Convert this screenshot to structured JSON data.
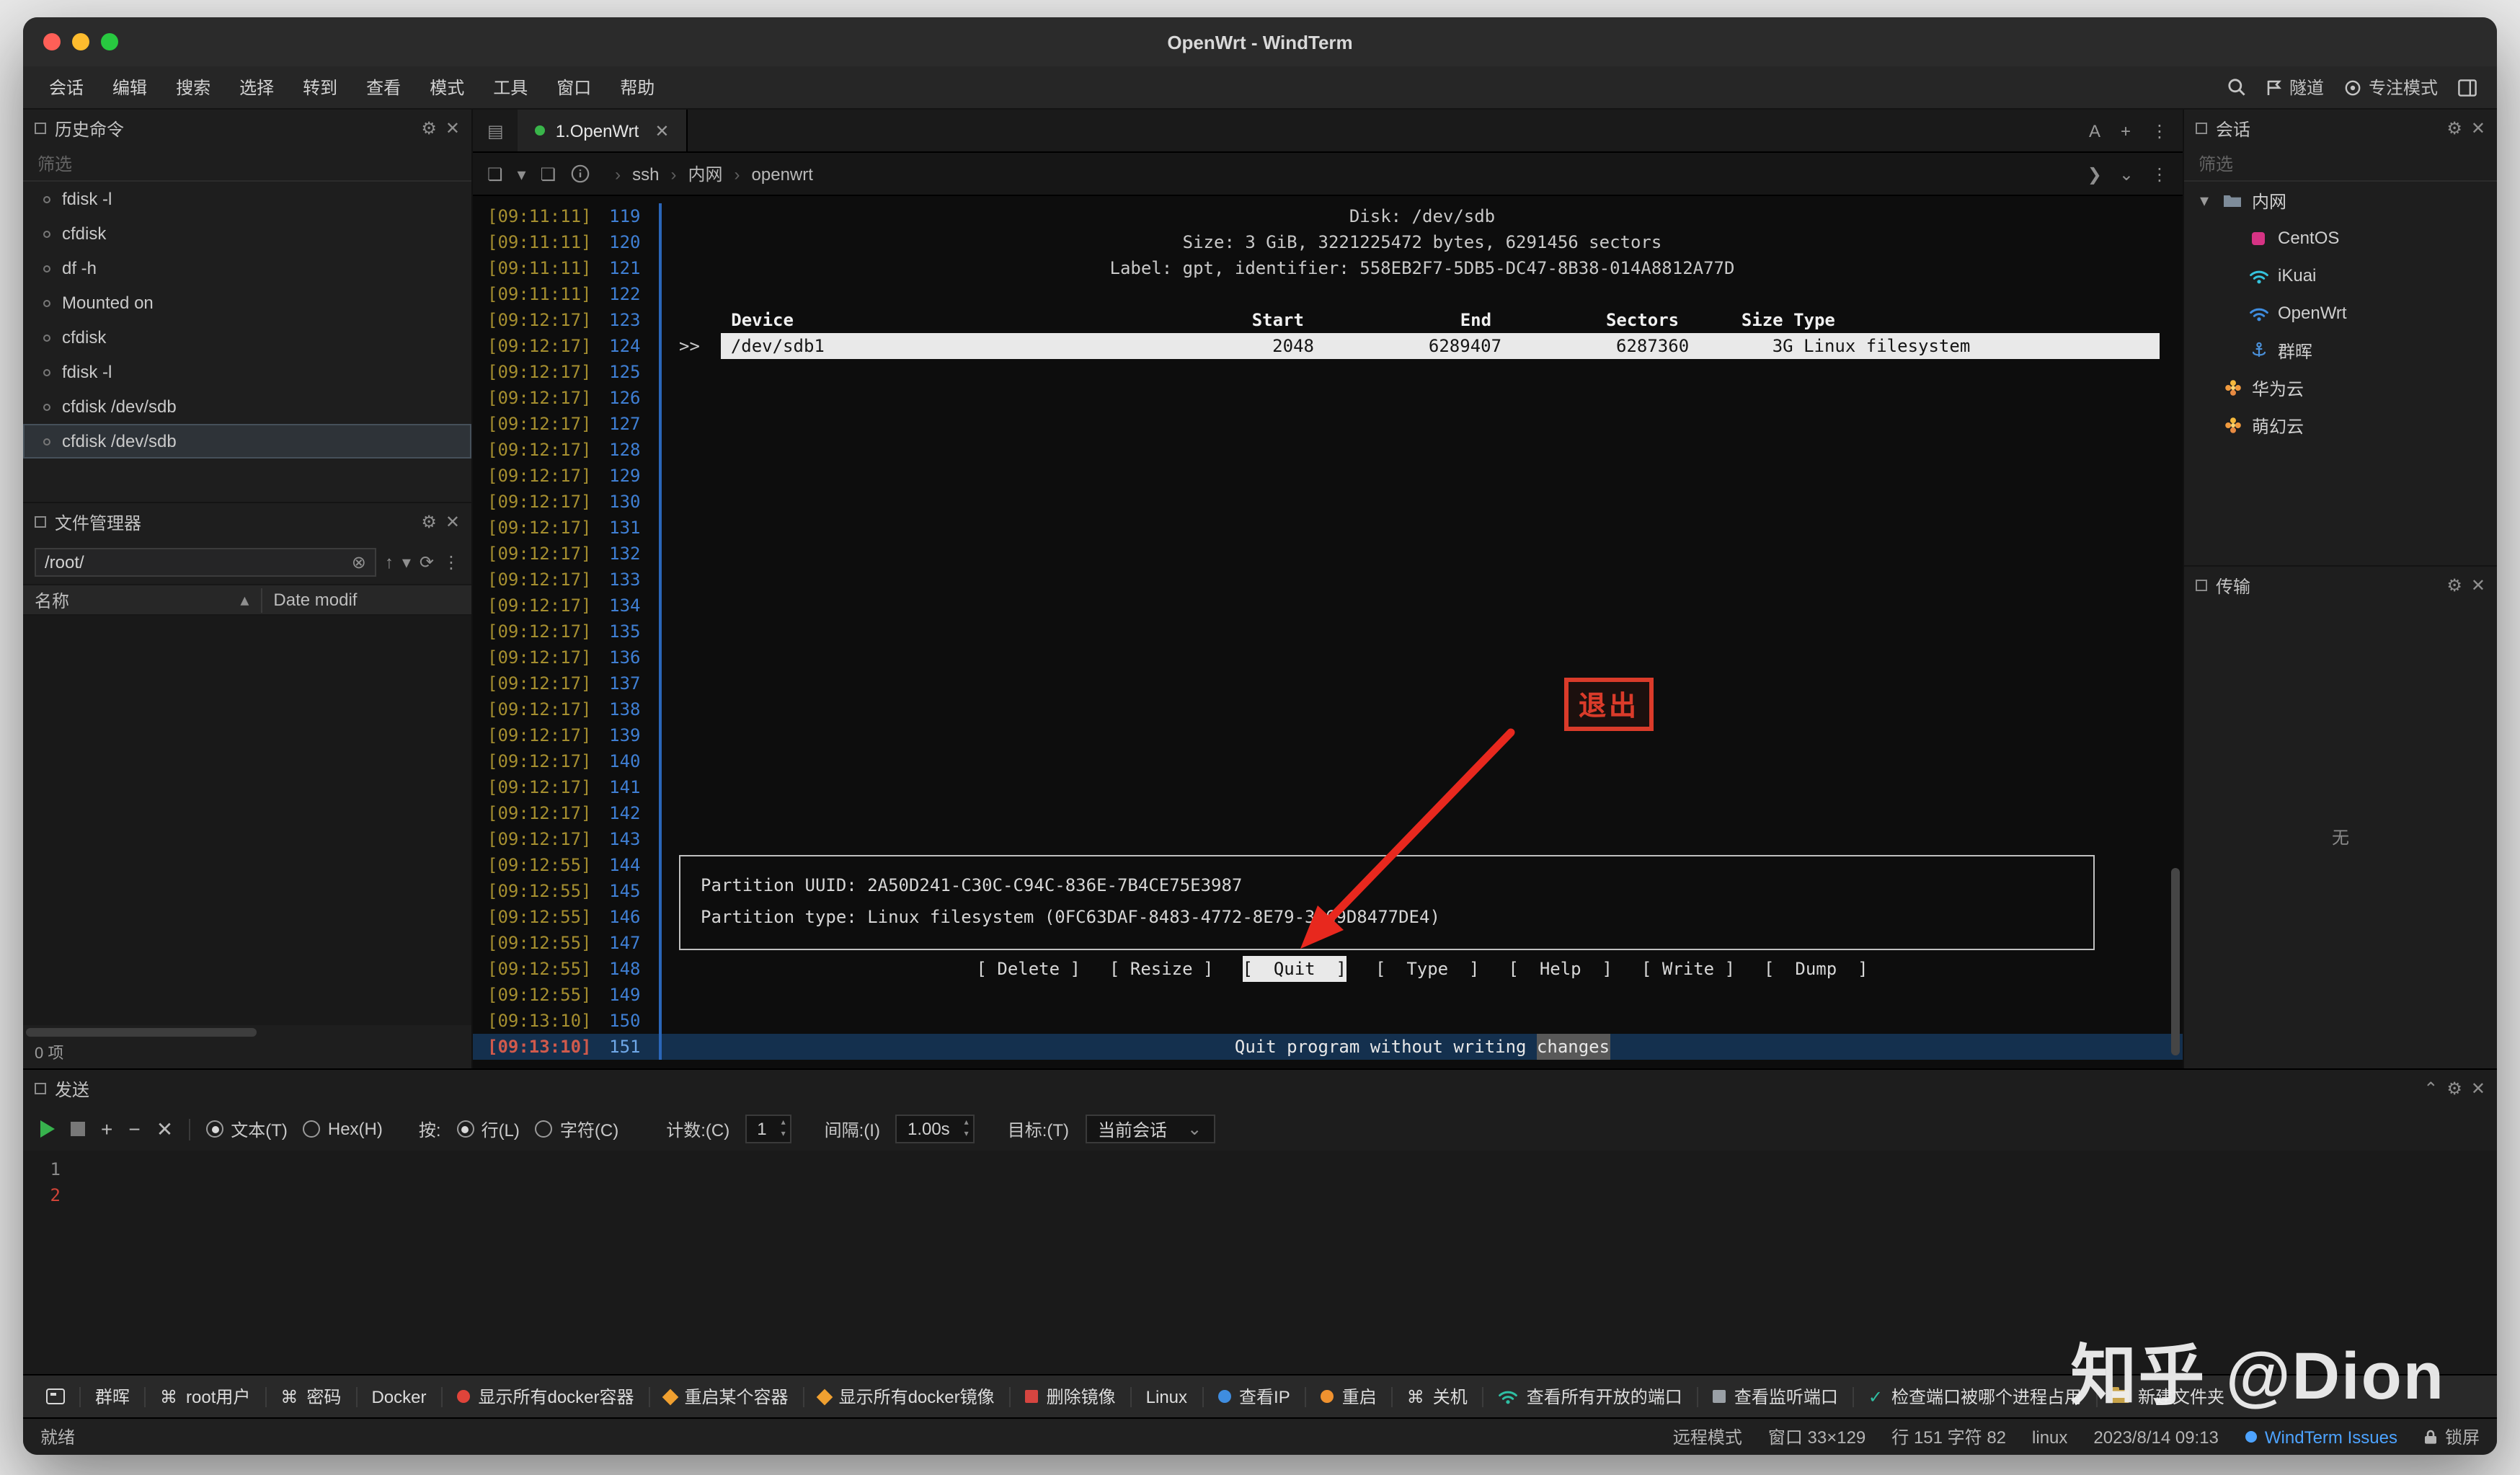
{
  "colors": {
    "accent_blue": "#3794ff",
    "timestamp": "#a58e2f",
    "line_number": "#3f7fd4",
    "annotation_red": "#da3b2a",
    "current_row_bg": "#14304e",
    "session_green": "#39b54a"
  },
  "icons": {
    "gear": "⚙",
    "close": "✕",
    "more": "⋮",
    "collapse": "⌃",
    "chevron_down": "⌄",
    "chevron_right": "›",
    "run": "❯",
    "sort_asc": "▴",
    "up": "↑",
    "refresh": "⟳",
    "clear": "⊗",
    "plus": "+",
    "minus": "−",
    "cross": "✕",
    "letterA": "A",
    "tab_grid": "▤",
    "split": "❏",
    "caret": "▾"
  },
  "titlebar": {
    "title": "OpenWrt - WindTerm"
  },
  "menubar": {
    "items": [
      "会话",
      "编辑",
      "搜索",
      "选择",
      "转到",
      "查看",
      "模式",
      "工具",
      "窗口",
      "帮助"
    ],
    "right_tunnel": "隧道",
    "right_focus": "专注模式"
  },
  "history_panel": {
    "title": "历史命令",
    "filter": "筛选",
    "items": [
      "fdisk -l",
      "cfdisk",
      "df -h",
      "Mounted on",
      "cfdisk",
      "fdisk -l",
      "cfdisk /dev/sdb",
      "cfdisk /dev/sdb"
    ],
    "selected_index": 7
  },
  "file_panel": {
    "title": "文件管理器",
    "path": "/root/",
    "col_name": "名称",
    "col_date": "Date modif",
    "count": "0 项"
  },
  "terminal": {
    "tab_label": "1.OpenWrt",
    "breadcrumb": [
      "ssh",
      "内网",
      "openwrt"
    ],
    "first_line": 119,
    "rows": 33,
    "gutter_segments": [
      {
        "time": "[09:11:11]",
        "from": 119,
        "to": 122
      },
      {
        "time": "[09:12:17]",
        "from": 123,
        "to": 143
      },
      {
        "time": "[09:12:55]",
        "from": 144,
        "to": 149
      },
      {
        "time": "[09:13:10]",
        "from": 150,
        "to": 151
      }
    ],
    "layout": {
      "disk": 119,
      "header": 123,
      "row": 124,
      "box": 144,
      "menu": 148,
      "hint": 151
    },
    "disk_info": {
      "line1": "Disk: /dev/sdb",
      "line2": "Size: 3 GiB, 3221225472 bytes, 6291456 sectors",
      "line3": "Label: gpt, identifier: 558EB2F7-5DB5-DC47-8B38-014A8812A77D"
    },
    "table": {
      "header": "     Device                                            Start               End           Sectors      Size Type",
      "row_prefix": ">>  ",
      "row_text": "/dev/sdb1                                           2048           6289407           6287360        3G Linux filesystem"
    },
    "partition_box": {
      "line1": "Partition UUID: 2A50D241-C30C-C94C-836E-7B4CE75E3987",
      "line2": "Partition type: Linux filesystem (0FC63DAF-8483-4772-8E79-3D69D8477DE4)"
    },
    "menu_buttons": [
      "[ Delete ]",
      "[ Resize ]",
      "[  Quit  ]",
      "[  Type  ]",
      "[  Help  ]",
      "[ Write ]",
      "[  Dump  ]"
    ],
    "selected_button_index": 2,
    "hint_line": {
      "prefix": "Quit program without writing ",
      "highlight": "changes"
    },
    "annotation": "退出"
  },
  "sessions_panel": {
    "title": "会话",
    "filter": "筛选",
    "tree": [
      {
        "label": "内网",
        "type": "folder",
        "level": 0,
        "expanded": true
      },
      {
        "label": "CentOS",
        "type": "centos",
        "level": 1
      },
      {
        "label": "iKuai",
        "type": "wifi-cyan",
        "level": 1
      },
      {
        "label": "OpenWrt",
        "type": "wifi-blue",
        "level": 1
      },
      {
        "label": "群晖",
        "type": "anchor",
        "level": 1
      },
      {
        "label": "华为云",
        "type": "flower",
        "level": 0
      },
      {
        "label": "萌幻云",
        "type": "flower",
        "level": 0
      }
    ]
  },
  "transfer_panel": {
    "title": "传输",
    "empty": "无"
  },
  "send_panel": {
    "title": "发送",
    "radio_text": "文本(T)",
    "radio_hex": "Hex(H)",
    "by_label": "按:",
    "radio_line": "行(L)",
    "radio_char": "字符(C)",
    "count_label": "计数:(C)",
    "count_value": "1",
    "interval_label": "间隔:(I)",
    "interval_value": "1.00s",
    "target_label": "目标:(T)",
    "target_value": "当前会话",
    "lines": [
      "1",
      "2"
    ]
  },
  "quick_bar": {
    "items": [
      {
        "icon": "console",
        "label": ""
      },
      {
        "icon": "",
        "label": "群晖"
      },
      {
        "icon": "cmd",
        "label": "root用户"
      },
      {
        "icon": "cmd",
        "label": "密码"
      },
      {
        "icon": "",
        "label": "Docker"
      },
      {
        "icon": "dot-red",
        "label": "显示所有docker容器"
      },
      {
        "icon": "bolt-orange",
        "label": "重启某个容器"
      },
      {
        "icon": "bolt-orange",
        "label": "显示所有docker镜像"
      },
      {
        "icon": "grid-red",
        "label": "删除镜像"
      },
      {
        "icon": "",
        "label": "Linux"
      },
      {
        "icon": "dot-blue",
        "label": "查看IP"
      },
      {
        "icon": "dot-orange",
        "label": "重启"
      },
      {
        "icon": "cmd",
        "label": "关机"
      },
      {
        "icon": "wifi-teal",
        "label": "查看所有开放的端口"
      },
      {
        "icon": "grid-gray",
        "label": "查看监听端口"
      },
      {
        "icon": "check-teal",
        "label": "检查端口被哪个进程占用"
      },
      {
        "icon": "folder",
        "label": "新建文件夹"
      }
    ]
  },
  "status_bar": {
    "left": "就绪",
    "mode": "远程模式",
    "window_size": "窗口 33×129",
    "cursor": "行 151 字符 82",
    "os": "linux",
    "datetime": "2023/8/14 09:13",
    "issues": "WindTerm Issues",
    "lock": "锁屏"
  },
  "watermark": "知乎 @Dion"
}
